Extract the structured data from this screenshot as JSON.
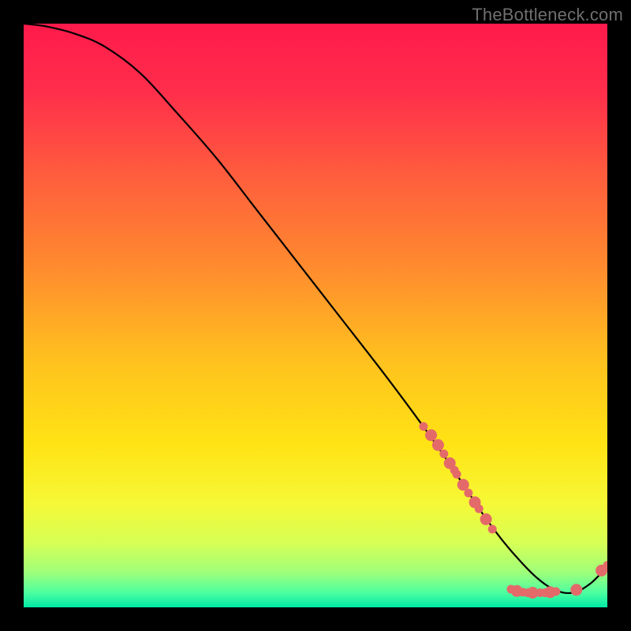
{
  "watermark": "TheBottleneck.com",
  "gradient": {
    "stops": [
      {
        "offset": 0.0,
        "color": "#ff1a4b"
      },
      {
        "offset": 0.12,
        "color": "#ff2f4b"
      },
      {
        "offset": 0.25,
        "color": "#ff5a3e"
      },
      {
        "offset": 0.42,
        "color": "#ff8c2e"
      },
      {
        "offset": 0.58,
        "color": "#ffc21e"
      },
      {
        "offset": 0.72,
        "color": "#ffe314"
      },
      {
        "offset": 0.82,
        "color": "#f6f836"
      },
      {
        "offset": 0.89,
        "color": "#d6ff55"
      },
      {
        "offset": 0.94,
        "color": "#9fff7a"
      },
      {
        "offset": 0.975,
        "color": "#4dffa0"
      },
      {
        "offset": 1.0,
        "color": "#00e9a5"
      }
    ]
  },
  "chart_data": {
    "type": "line",
    "title": "",
    "xlabel": "",
    "ylabel": "",
    "xlim": [
      0,
      100
    ],
    "ylim": [
      0,
      100
    ],
    "series": [
      {
        "name": "bottleneck-curve",
        "x": [
          0,
          4,
          9,
          14,
          20,
          26,
          33,
          40,
          47,
          54,
          61,
          67,
          72,
          76,
          79,
          82,
          85,
          88,
          91,
          94,
          97,
          100
        ],
        "y": [
          100,
          99.5,
          98.2,
          96.0,
          91.5,
          85.0,
          77.0,
          68.0,
          59.0,
          50.0,
          41.0,
          33.0,
          26.0,
          20.0,
          15.5,
          11.5,
          8.0,
          5.0,
          3.0,
          2.5,
          4.0,
          7.0
        ]
      }
    ],
    "markers": {
      "name": "highlight-points",
      "color": "#e46a6a",
      "radius_small": 5.5,
      "radius_large": 7.5,
      "points": [
        {
          "x": 68.5,
          "y": 31.0,
          "r": "small"
        },
        {
          "x": 69.8,
          "y": 29.5,
          "r": "large"
        },
        {
          "x": 71.0,
          "y": 27.8,
          "r": "large"
        },
        {
          "x": 72.0,
          "y": 26.3,
          "r": "small"
        },
        {
          "x": 73.0,
          "y": 24.7,
          "r": "large"
        },
        {
          "x": 73.8,
          "y": 23.5,
          "r": "small"
        },
        {
          "x": 74.2,
          "y": 22.8,
          "r": "small"
        },
        {
          "x": 75.3,
          "y": 21.0,
          "r": "large"
        },
        {
          "x": 76.2,
          "y": 19.6,
          "r": "small"
        },
        {
          "x": 77.3,
          "y": 18.0,
          "r": "large"
        },
        {
          "x": 78.0,
          "y": 16.9,
          "r": "small"
        },
        {
          "x": 79.2,
          "y": 15.1,
          "r": "large"
        },
        {
          "x": 80.3,
          "y": 13.4,
          "r": "small"
        },
        {
          "x": 83.5,
          "y": 3.1,
          "r": "small"
        },
        {
          "x": 84.5,
          "y": 2.8,
          "r": "large"
        },
        {
          "x": 85.5,
          "y": 2.6,
          "r": "small"
        },
        {
          "x": 86.3,
          "y": 2.5,
          "r": "small"
        },
        {
          "x": 87.2,
          "y": 2.5,
          "r": "large"
        },
        {
          "x": 88.5,
          "y": 2.5,
          "r": "small"
        },
        {
          "x": 89.3,
          "y": 2.5,
          "r": "small"
        },
        {
          "x": 90.2,
          "y": 2.6,
          "r": "large"
        },
        {
          "x": 91.2,
          "y": 2.7,
          "r": "small"
        },
        {
          "x": 94.7,
          "y": 3.0,
          "r": "large"
        },
        {
          "x": 99.0,
          "y": 6.3,
          "r": "large"
        },
        {
          "x": 100.0,
          "y": 7.2,
          "r": "small"
        }
      ]
    }
  }
}
